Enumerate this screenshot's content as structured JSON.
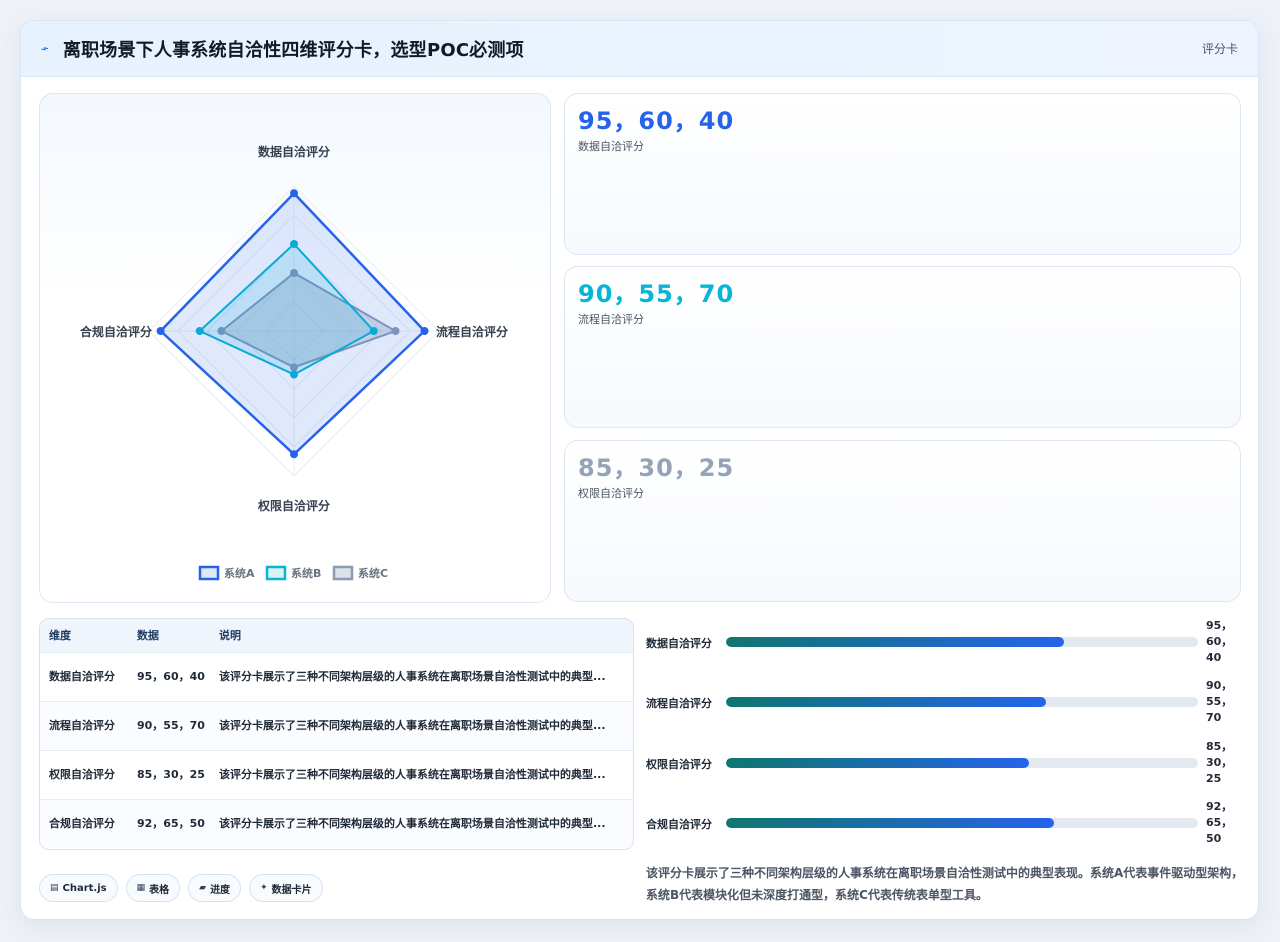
{
  "header": {
    "title": "离职场景下人事系统自洽性四维评分卡，选型POC必测项",
    "tag": "评分卡"
  },
  "colors": {
    "system_a": "#2563eb",
    "system_b": "#06b6d4",
    "system_c": "#8b9bb4"
  },
  "chart_data": {
    "type": "radar",
    "axes": [
      "数据自洽评分",
      "流程自洽评分",
      "权限自洽评分",
      "合规自洽评分"
    ],
    "rmax": 100,
    "grid": true,
    "legend_position": "bottom",
    "series": [
      {
        "name": "系统A",
        "values": [
          95,
          90,
          85,
          92
        ],
        "color": "#2563eb"
      },
      {
        "name": "系统B",
        "values": [
          60,
          55,
          30,
          65
        ],
        "color": "#06b6d4"
      },
      {
        "name": "系统C",
        "values": [
          40,
          70,
          25,
          50
        ],
        "color": "#8b9bb4"
      }
    ]
  },
  "stats": [
    {
      "value": "95，60，40",
      "label": "数据自洽评分",
      "color": "#2563eb"
    },
    {
      "value": "90，55，70",
      "label": "流程自洽评分",
      "color": "#06b6d4"
    },
    {
      "value": "85，30，25",
      "label": "权限自洽评分",
      "color": "#94a3b8"
    }
  ],
  "table": {
    "headers": [
      "维度",
      "数据",
      "说明"
    ],
    "rows": [
      {
        "dim": "数据自洽评分",
        "data": "95，60，40",
        "desc": "该评分卡展示了三种不同架构层级的人事系统在离职场景自洽性测试中的典型..."
      },
      {
        "dim": "流程自洽评分",
        "data": "90，55，70",
        "desc": "该评分卡展示了三种不同架构层级的人事系统在离职场景自洽性测试中的典型..."
      },
      {
        "dim": "权限自洽评分",
        "data": "85，30，25",
        "desc": "该评分卡展示了三种不同架构层级的人事系统在离职场景自洽性测试中的典型..."
      },
      {
        "dim": "合规自洽评分",
        "data": "92，65，50",
        "desc": "该评分卡展示了三种不同架构层级的人事系统在离职场景自洽性测试中的典型..."
      }
    ]
  },
  "bars": [
    {
      "label": "数据自洽评分",
      "value": "95，60，40",
      "fill_pct": 0.716
    },
    {
      "label": "流程自洽评分",
      "value": "90，55，70",
      "fill_pct": 0.679
    },
    {
      "label": "权限自洽评分",
      "value": "85，30，25",
      "fill_pct": 0.642
    },
    {
      "label": "合规自洽评分",
      "value": "92，65，50",
      "fill_pct": 0.695
    }
  ],
  "chips": [
    {
      "icon": "chart-icon",
      "label": "Chart.js"
    },
    {
      "icon": "table-icon",
      "label": "表格"
    },
    {
      "icon": "progress-icon",
      "label": "进度"
    },
    {
      "icon": "sparkle-icon",
      "label": "数据卡片"
    }
  ],
  "summary": "该评分卡展示了三种不同架构层级的人事系统在离职场景自洽性测试中的典型表现。系统A代表事件驱动型架构，系统B代表模块化但未深度打通型，系统C代表传统表单型工具。"
}
